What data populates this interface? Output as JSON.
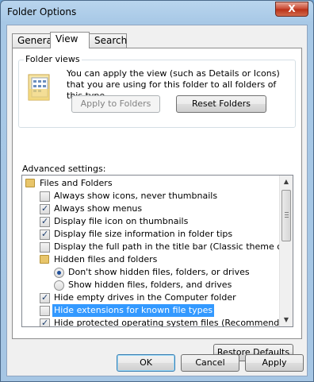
{
  "window": {
    "title": "Folder Options",
    "close_label": "X"
  },
  "tabs": [
    {
      "label": "General"
    },
    {
      "label": "View"
    },
    {
      "label": "Search"
    }
  ],
  "folder_views": {
    "title": "Folder views",
    "description": "You can apply the view (such as Details or Icons) that you are using for this folder to all folders of this type.",
    "apply_label": "Apply to Folders",
    "reset_label": "Reset Folders"
  },
  "advanced": {
    "label": "Advanced settings:",
    "items": [
      {
        "type": "folder",
        "label": "Files and Folders",
        "indent": 0
      },
      {
        "type": "checkbox",
        "label": "Always show icons, never thumbnails",
        "checked": false,
        "indent": 1
      },
      {
        "type": "checkbox",
        "label": "Always show menus",
        "checked": true,
        "indent": 1
      },
      {
        "type": "checkbox",
        "label": "Display file icon on thumbnails",
        "checked": true,
        "indent": 1
      },
      {
        "type": "checkbox",
        "label": "Display file size information in folder tips",
        "checked": true,
        "indent": 1
      },
      {
        "type": "checkbox",
        "label": "Display the full path in the title bar (Classic theme only)",
        "checked": false,
        "indent": 1
      },
      {
        "type": "folder",
        "label": "Hidden files and folders",
        "indent": 1
      },
      {
        "type": "radio",
        "label": "Don't show hidden files, folders, or drives",
        "checked": true,
        "indent": 2
      },
      {
        "type": "radio",
        "label": "Show hidden files, folders, and drives",
        "checked": false,
        "indent": 2
      },
      {
        "type": "checkbox",
        "label": "Hide empty drives in the Computer folder",
        "checked": true,
        "indent": 1
      },
      {
        "type": "checkbox",
        "label": "Hide extensions for known file types",
        "checked": false,
        "indent": 1,
        "selected": true
      },
      {
        "type": "checkbox",
        "label": "Hide protected operating system files (Recommended)",
        "checked": true,
        "indent": 1
      }
    ],
    "restore_label": "Restore Defaults"
  },
  "footer": {
    "ok_label": "OK",
    "cancel_label": "Cancel",
    "apply_label": "Apply"
  },
  "colors": {
    "selection": "#3399ff",
    "titlebar": "#b9d5ee",
    "close": "#c7452f"
  }
}
